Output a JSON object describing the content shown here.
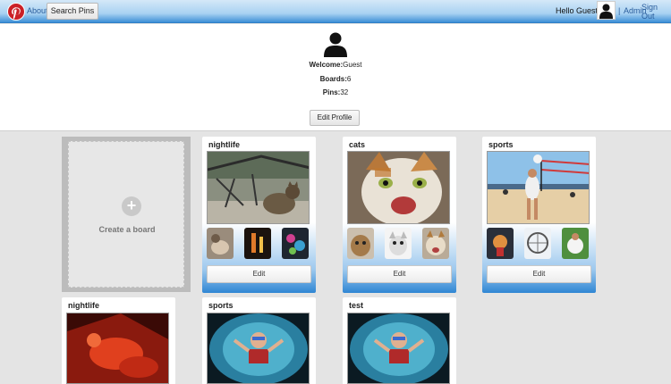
{
  "topbar": {
    "about": "About",
    "search_button": "Search Pins",
    "greeting": "Hello Guest!",
    "separator": "|",
    "admin": "Admin",
    "sign_out": "Sign Out"
  },
  "profile": {
    "welcome_label": "Welcome:",
    "welcome_value": "Guest",
    "boards_label": "Boards:",
    "boards_value": "6",
    "pins_label": "Pins:",
    "pins_value": "32",
    "edit_button": "Edit Profile"
  },
  "create_board": {
    "icon": "plus-icon",
    "label": "Create a board"
  },
  "boards": [
    {
      "title": "nightlife",
      "edit": "Edit"
    },
    {
      "title": "cats",
      "edit": "Edit"
    },
    {
      "title": "sports",
      "edit": "Edit"
    },
    {
      "title": "nightlife"
    },
    {
      "title": "sports"
    },
    {
      "title": "test"
    }
  ],
  "colors": {
    "topbar_blue": "#3d8fd6",
    "logo_red": "#cb2027",
    "link_blue": "#2a5d9c",
    "board_gradient_bottom": "#2f86d4"
  }
}
